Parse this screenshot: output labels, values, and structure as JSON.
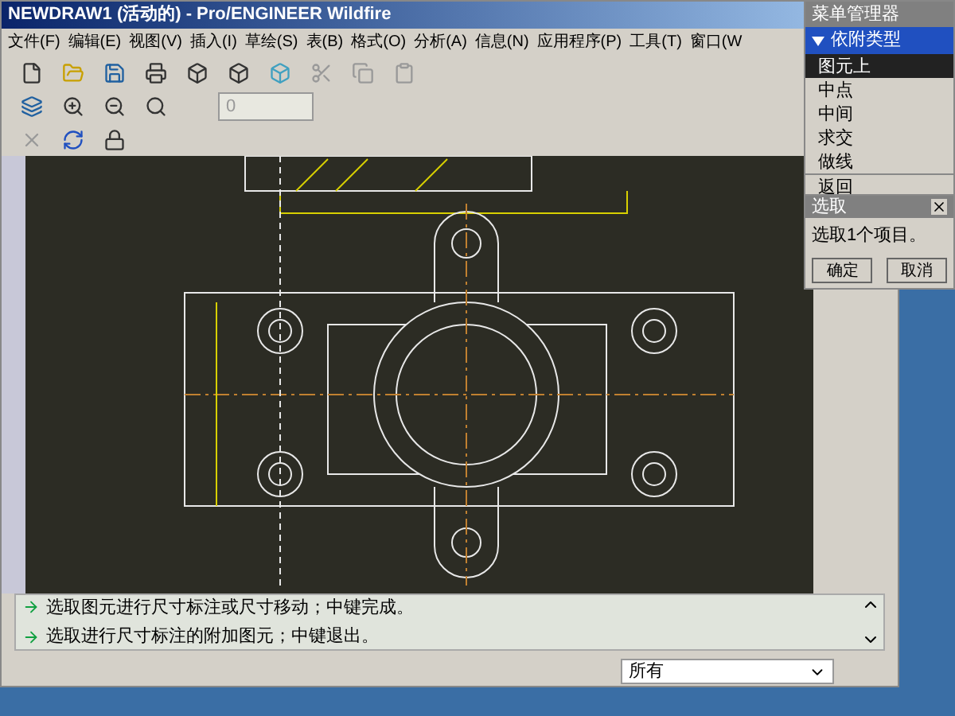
{
  "window": {
    "title": "NEWDRAW1 (活动的) - Pro/ENGINEER Wildfire"
  },
  "menu_bar": [
    "文件(F)",
    "编辑(E)",
    "视图(V)",
    "插入(I)",
    "草绘(S)",
    "表(B)",
    "格式(O)",
    "分析(A)",
    "信息(N)",
    "应用程序(P)",
    "工具(T)",
    "窗口(W"
  ],
  "toolbar": {
    "spin_value": "0"
  },
  "menu_manager": {
    "title": "菜单管理器",
    "header": "依附类型",
    "items": [
      {
        "label": "图元上",
        "selected": true
      },
      {
        "label": "中点",
        "selected": false
      },
      {
        "label": "中间",
        "selected": false
      },
      {
        "label": "求交",
        "selected": false
      },
      {
        "label": "做线",
        "selected": false
      }
    ],
    "back": "返回"
  },
  "select_dialog": {
    "title": "选取",
    "message": "选取1个项目。",
    "buttons": [
      "确定",
      "取消"
    ]
  },
  "messages": [
    "选取图元进行尺寸标注或尺寸移动；中键完成。",
    "选取进行尺寸标注的附加图元；中键退出。"
  ],
  "filter": {
    "value": "所有"
  }
}
